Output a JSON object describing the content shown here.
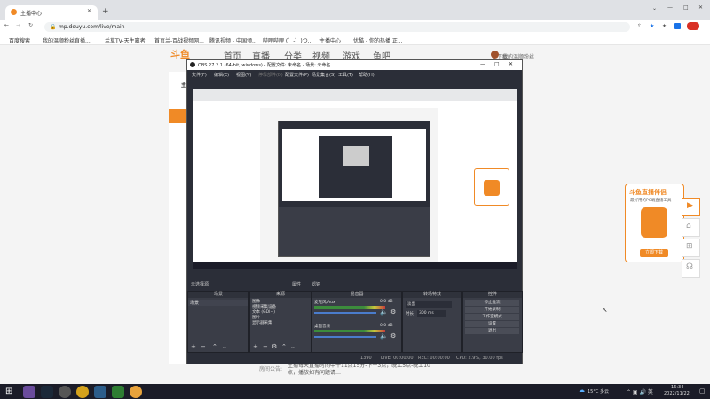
{
  "browser": {
    "tab_title": "主播中心",
    "url": "mp.douyu.com/live/main",
    "bookmarks": [
      "百度搜索",
      "我的温顺粉丝直播...",
      "兰草TV-天生赢者",
      "首页兰-百战视频网...",
      "腾讯视频 - 中国领...",
      "哔哩哔哩 (゜-゜)つ...",
      "主播中心",
      "优酷 - 你的热播 正..."
    ]
  },
  "site": {
    "logo": "斗鱼",
    "nav": [
      "首页",
      "直播",
      "分类",
      "视频",
      "游戏",
      "鱼吧"
    ],
    "user_download": "下载",
    "user_name": "我的温顺粉丝",
    "sidebar_label": "主",
    "announcement_label": "房间公告:",
    "announcement_text": "主播每天直播时间中午11点15分-下午3点，晚上5点-晚上10点，播放如有问题请…"
  },
  "obs": {
    "title": "OBS 27.2.1 (64-bit, windows) - 配置文件: 未命名 - 场景: 未命名",
    "menu": [
      "文件(F)",
      "编辑(E)",
      "视图(V)",
      "停靠部件(D)",
      "配置文件(P)",
      "场景集合(S)",
      "工具(T)",
      "帮助(H)"
    ],
    "source_bar": "未选择源",
    "props_label": "属性",
    "filters_label": "滤镜",
    "docks": {
      "scenes": "场景",
      "sources": "来源",
      "mixer": "混音器",
      "transitions": "转场特效",
      "controls": "控件"
    },
    "scene_items": [
      "场景"
    ],
    "source_items": [
      "图像",
      "视频采集设备",
      "文本 (GDI+)",
      "图片",
      "显示器采集"
    ],
    "mixer_tracks": [
      {
        "name": "麦克风/Aux",
        "db": "0.0 dB"
      },
      {
        "name": "桌面音频",
        "db": "0.0 dB"
      }
    ],
    "transition_name": "淡出",
    "duration_label": "时长",
    "duration_value": "300 ms",
    "control_buttons": [
      "停止推流",
      "开始录制",
      "工作室模式",
      "设置",
      "退出"
    ],
    "status": {
      "live": "LIVE: 00:00:00",
      "rec": "REC: 00:00:00",
      "cpu": "CPU: 2.9%, 30.00 fps",
      "kb": "1390"
    }
  },
  "widget": {
    "title": "斗鱼直播伴侣",
    "subtitle": "最好用的PC端直播工具",
    "button": "立即下载"
  },
  "taskbar": {
    "weather": "15°C 多云",
    "time": "16:34",
    "date": "2022/11/22"
  }
}
